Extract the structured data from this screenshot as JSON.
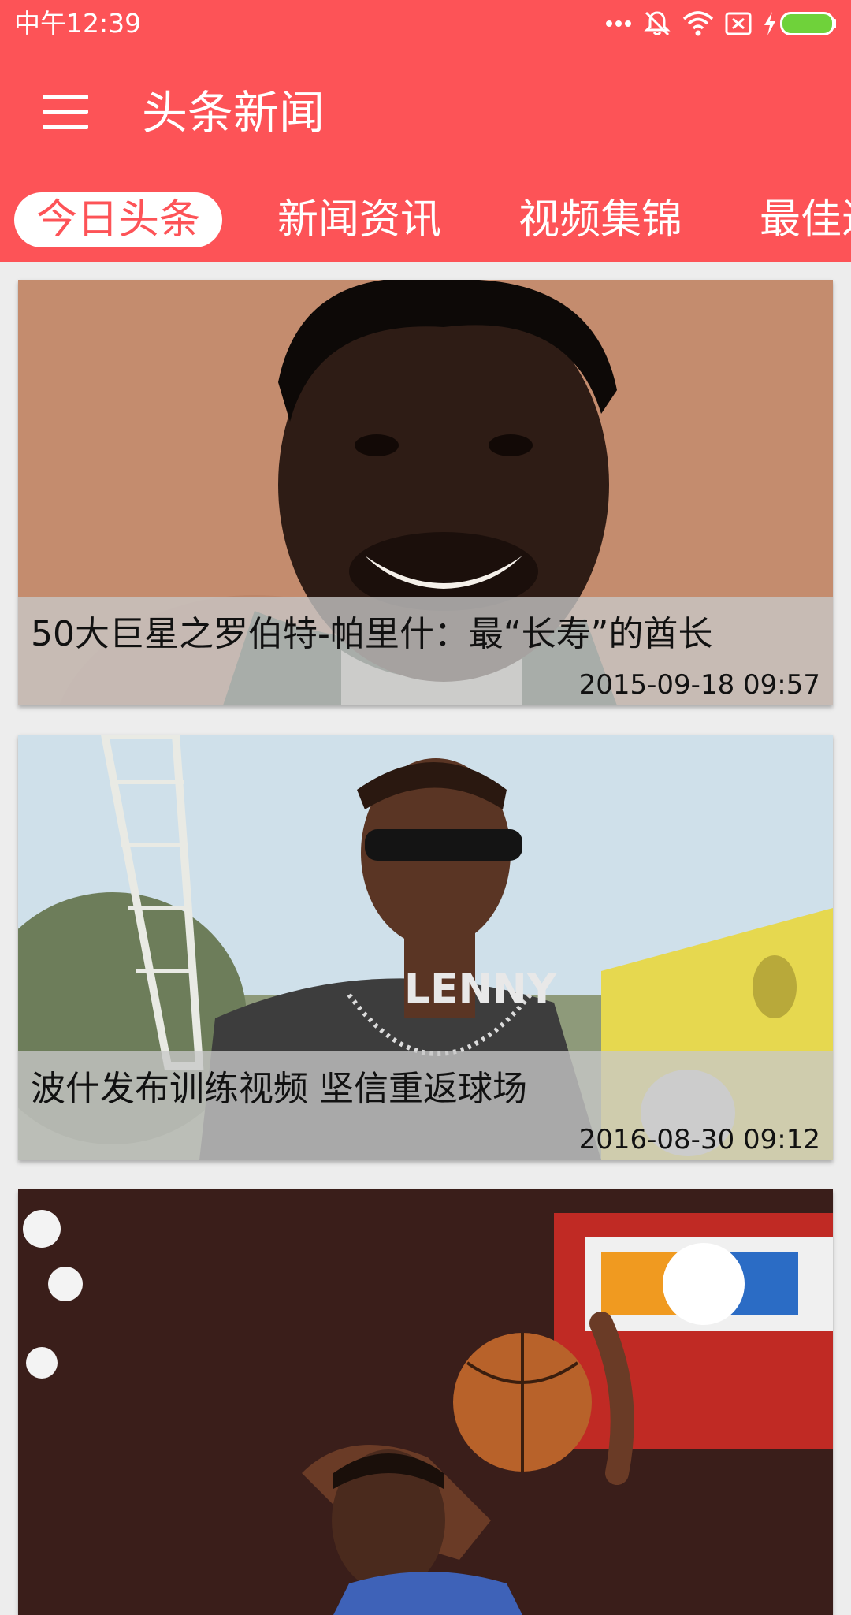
{
  "status_bar": {
    "time": "中午12:39",
    "icons": [
      "more-dots-icon",
      "mute-icon",
      "wifi-icon",
      "sim-icon",
      "charging-icon",
      "battery-icon"
    ]
  },
  "app_bar": {
    "title": "头条新闻",
    "menu_icon": "hamburger-menu-icon"
  },
  "tabs": [
    {
      "label": "今日头条",
      "active": true
    },
    {
      "label": "新闻资讯",
      "active": false
    },
    {
      "label": "视频集锦",
      "active": false
    },
    {
      "label": "最佳进",
      "active": false
    }
  ],
  "news": [
    {
      "title": "50大巨星之罗伯特-帕里什：最“长寿”的酋长",
      "time": "2015-09-18 09:57"
    },
    {
      "title": "波什发布训练视频 坚信重返球场",
      "time": "2016-08-30 09:12"
    },
    {
      "title": "",
      "time": ""
    }
  ],
  "colors": {
    "accent": "#fd5357",
    "background": "#ededed",
    "overlay": "#c8c8c8"
  }
}
